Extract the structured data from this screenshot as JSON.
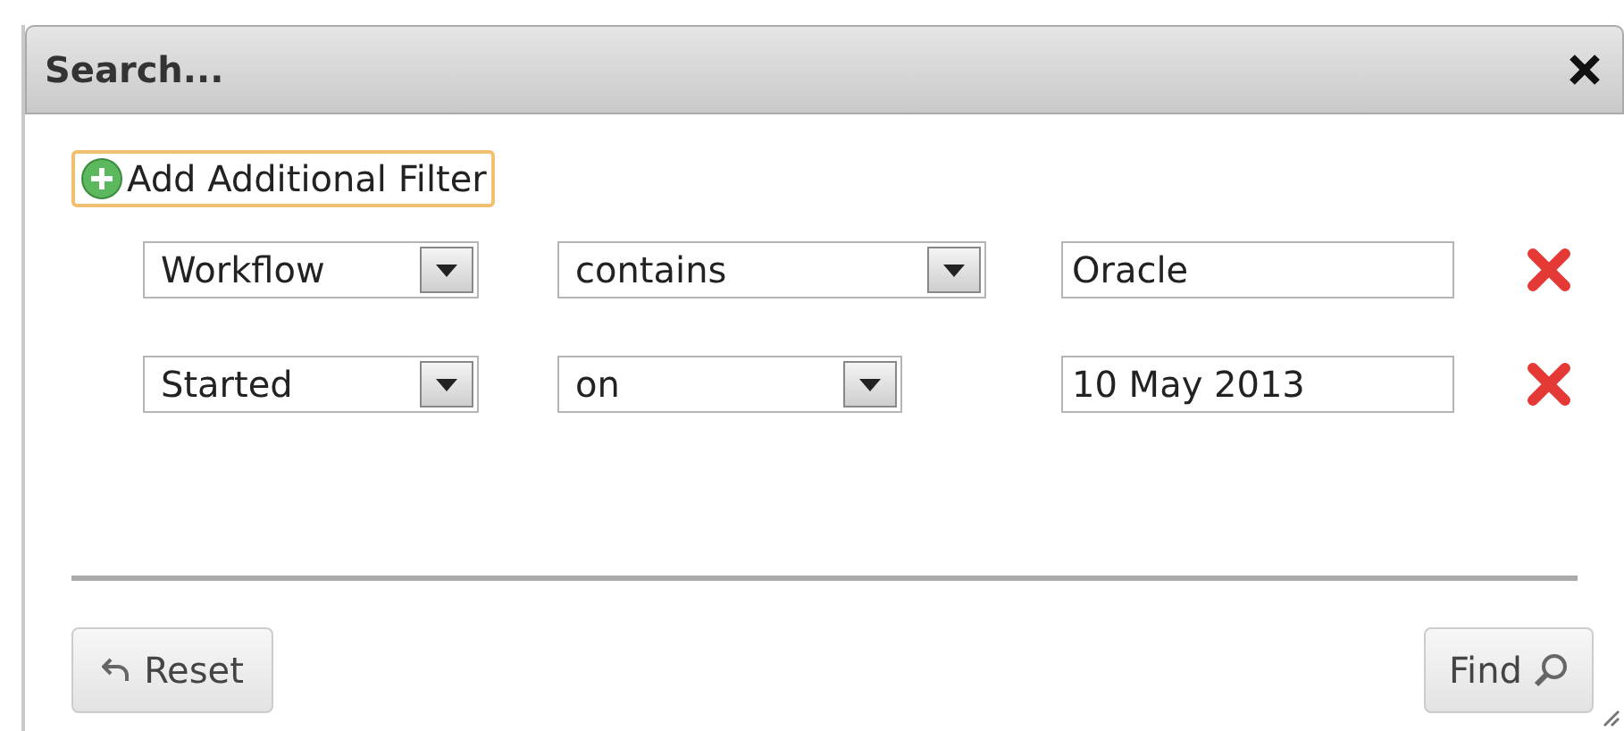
{
  "dialog": {
    "title": "Search...",
    "add_filter": "Add Additional Filter",
    "filters": [
      {
        "field": "Workflow",
        "operator": "contains",
        "value": "Oracle",
        "operator_wide": true
      },
      {
        "field": "Started",
        "operator": "on",
        "value": "10 May 2013",
        "operator_wide": false
      }
    ],
    "buttons": {
      "reset": "Reset",
      "find": "Find"
    }
  }
}
